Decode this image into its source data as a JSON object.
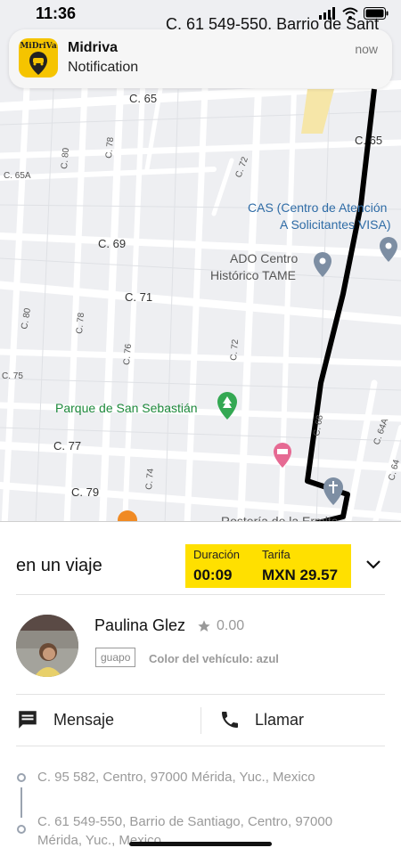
{
  "status_bar": {
    "time": "11:36",
    "address_overlay": "C. 61 549-550, Barrio de Sant"
  },
  "notification": {
    "app_brand": "MiDriVa",
    "title": "Midriva",
    "body": "Notification",
    "time": "now",
    "icon": "car-pin-icon",
    "accent_color": "#f5c400"
  },
  "map": {
    "street_labels": [
      "C. 65",
      "C. 65",
      "C. 65A",
      "C. 78",
      "C. 80",
      "C. 72",
      "C. 69",
      "C. 71",
      "C. 80",
      "C. 78",
      "C. 76",
      "C. 72",
      "C. 75",
      "C. 77",
      "C. 74",
      "C. 79",
      "C. 68",
      "C. 64A",
      "C. 64"
    ],
    "places": {
      "cas": "CAS (Centro de Atención A Solicitantes VISA)",
      "ado": "ADO Centro Histórico TAME",
      "park": "Parque de San Sebastián",
      "bakery": "Rostería de la Ermita"
    },
    "route_color": "#000000"
  },
  "trip": {
    "status": "en un viaje",
    "duration_label": "Duración",
    "duration_value": "00:09",
    "fare_label": "Tarifa",
    "fare_value": "MXN 29.57",
    "highlight_color": "#ffe000"
  },
  "driver": {
    "name": "Paulina Glez",
    "rating": "0.00",
    "plate": "guapo",
    "vehicle_color": "Color del vehículo: azul"
  },
  "actions": {
    "message_label": "Mensaje",
    "call_label": "Llamar"
  },
  "route": {
    "pickup": "C. 95 582, Centro, 97000 Mérida, Yuc., Mexico",
    "dropoff": "C. 61 549-550, Barrio de Santiago, Centro, 97000 Mérida, Yuc., Mexico"
  }
}
